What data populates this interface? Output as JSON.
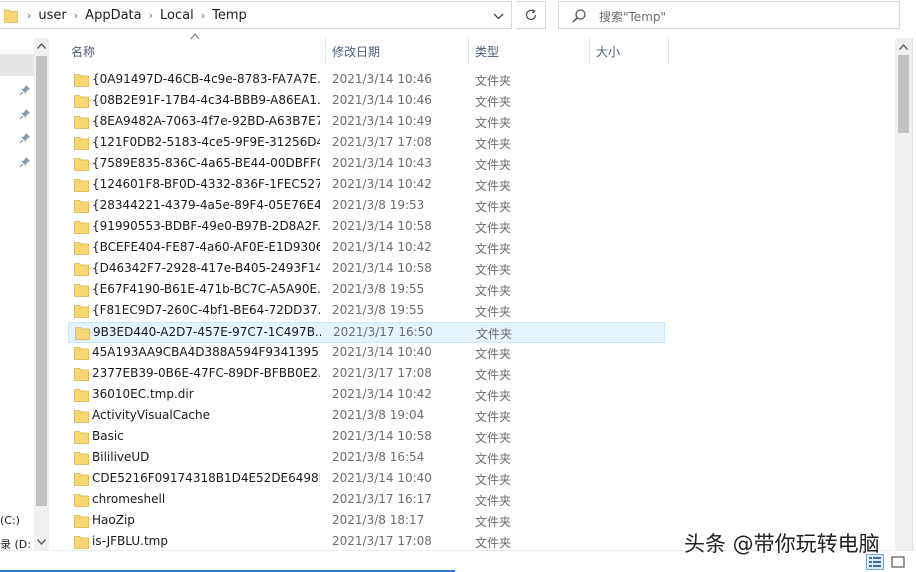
{
  "address": {
    "crumbs": [
      "user",
      "AppData",
      "Local",
      "Temp"
    ]
  },
  "search": {
    "placeholder": "搜索\"Temp\""
  },
  "columns": {
    "name": "名称",
    "date": "修改日期",
    "type": "类型",
    "size": "大小"
  },
  "nav": {
    "drive_c": "(C:)",
    "drive_d": "录 (D:"
  },
  "files": [
    {
      "name": "{0A91497D-46CB-4c9e-8783-FA7A7E...",
      "date": "2021/3/14 10:46",
      "type": "文件夹"
    },
    {
      "name": "{08B2E91F-17B4-4c34-BBB9-A86EA1...",
      "date": "2021/3/14 10:46",
      "type": "文件夹"
    },
    {
      "name": "{8EA9482A-7063-4f7e-92BD-A63B7E7...",
      "date": "2021/3/14 10:49",
      "type": "文件夹"
    },
    {
      "name": "{121F0DB2-5183-4ce5-9F9E-31256D4...",
      "date": "2021/3/17 17:08",
      "type": "文件夹"
    },
    {
      "name": "{7589E835-836C-4a65-BE44-00DBFFC...",
      "date": "2021/3/14 10:43",
      "type": "文件夹"
    },
    {
      "name": "{124601F8-BF0D-4332-836F-1FEC527...",
      "date": "2021/3/14 10:42",
      "type": "文件夹"
    },
    {
      "name": "{28344221-4379-4a5e-89F4-05E76E4...",
      "date": "2021/3/8 19:53",
      "type": "文件夹"
    },
    {
      "name": "{91990553-BDBF-49e0-B97B-2D8A2F...",
      "date": "2021/3/14 10:58",
      "type": "文件夹"
    },
    {
      "name": "{BCEFE404-FE87-4a60-AF0E-E1D9306...",
      "date": "2021/3/14 10:42",
      "type": "文件夹"
    },
    {
      "name": "{D46342F7-2928-417e-B405-2493F14...",
      "date": "2021/3/14 10:58",
      "type": "文件夹"
    },
    {
      "name": "{E67F4190-B61E-471b-BC7C-A5A90E...",
      "date": "2021/3/8 19:55",
      "type": "文件夹"
    },
    {
      "name": "{F81EC9D7-260C-4bf1-BE64-72DD37...",
      "date": "2021/3/8 19:55",
      "type": "文件夹"
    },
    {
      "name": "9B3ED440-A2D7-457E-97C7-1C497B...",
      "date": "2021/3/17 16:50",
      "type": "文件夹",
      "selected": true
    },
    {
      "name": "45A193AA9CBA4D388A594F9341395...",
      "date": "2021/3/14 10:40",
      "type": "文件夹"
    },
    {
      "name": "2377EB39-0B6E-47FC-89DF-BFBB0E2...",
      "date": "2021/3/17 17:08",
      "type": "文件夹"
    },
    {
      "name": "36010EC.tmp.dir",
      "date": "2021/3/14 10:42",
      "type": "文件夹"
    },
    {
      "name": "ActivityVisualCache",
      "date": "2021/3/8 19:04",
      "type": "文件夹"
    },
    {
      "name": "Basic",
      "date": "2021/3/14 10:58",
      "type": "文件夹"
    },
    {
      "name": "BililiveUD",
      "date": "2021/3/8 16:54",
      "type": "文件夹"
    },
    {
      "name": "CDE5216F09174318B1D4E52DE6498E...",
      "date": "2021/3/14 10:40",
      "type": "文件夹"
    },
    {
      "name": "chromeshell",
      "date": "2021/3/17 16:17",
      "type": "文件夹"
    },
    {
      "name": "HaoZip",
      "date": "2021/3/8 18:17",
      "type": "文件夹"
    },
    {
      "name": "is-JFBLU.tmp",
      "date": "2021/3/17 17:08",
      "type": "文件夹"
    }
  ],
  "watermark": "头条 @带你玩转电脑",
  "colors": {
    "folder": "#f7d774",
    "selection": "#e5f3ff",
    "selection_border": "#cce8ff",
    "header_text": "#4c607a",
    "accent": "#2f7ad1"
  }
}
